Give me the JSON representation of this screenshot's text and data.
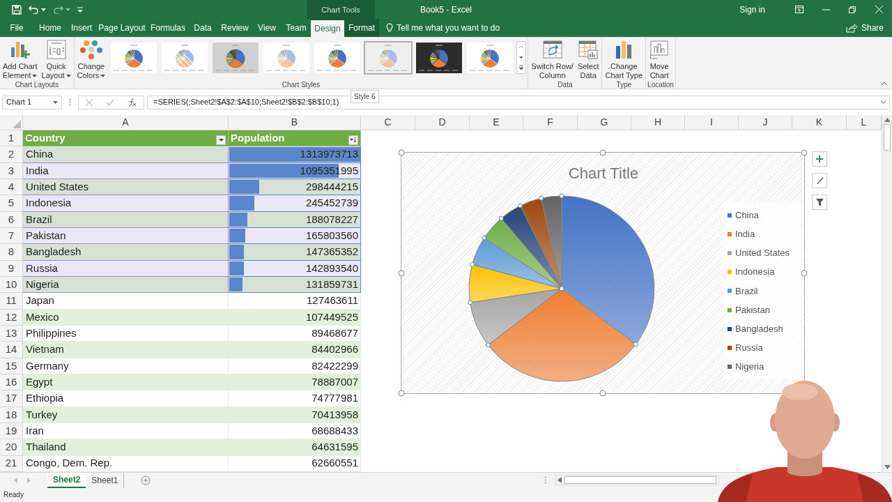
{
  "window": {
    "title": "Book5 - Excel",
    "account": "Sign in"
  },
  "context_label": "Chart Tools",
  "tabs": [
    {
      "label": "File",
      "selected": false,
      "contextual": false
    },
    {
      "label": "Home",
      "selected": false,
      "contextual": false
    },
    {
      "label": "Insert",
      "selected": false,
      "contextual": false
    },
    {
      "label": "Page Layout",
      "selected": false,
      "contextual": false
    },
    {
      "label": "Formulas",
      "selected": false,
      "contextual": false
    },
    {
      "label": "Data",
      "selected": false,
      "contextual": false
    },
    {
      "label": "Review",
      "selected": false,
      "contextual": false
    },
    {
      "label": "View",
      "selected": false,
      "contextual": false
    },
    {
      "label": "Team",
      "selected": false,
      "contextual": false
    },
    {
      "label": "Design",
      "selected": true,
      "contextual": true
    },
    {
      "label": "Format",
      "selected": false,
      "contextual": true
    }
  ],
  "tell_me": "Tell me what you want to do",
  "share": "Share",
  "ribbon": {
    "groups": [
      {
        "label": "Chart Layouts",
        "buttons": [
          {
            "lines": [
              "Add Chart",
              "Element"
            ],
            "dropdown": true
          },
          {
            "lines": [
              "Quick",
              "Layout"
            ],
            "dropdown": true
          }
        ]
      },
      {
        "label": "Chart Styles",
        "buttons": [
          {
            "lines": [
              "Change",
              "Colors"
            ],
            "dropdown": true
          }
        ],
        "gallery": [
          {
            "kind": "plain",
            "selected": false
          },
          {
            "kind": "striped",
            "selected": false
          },
          {
            "kind": "gray",
            "selected": false
          },
          {
            "kind": "pale",
            "selected": false
          },
          {
            "kind": "plain",
            "selected": false
          },
          {
            "kind": "hatched",
            "selected": true
          },
          {
            "kind": "dark",
            "selected": false
          },
          {
            "kind": "plain",
            "selected": false
          }
        ]
      },
      {
        "label": "Data",
        "buttons": [
          {
            "lines": [
              "Switch Row/",
              "Column"
            ],
            "dropdown": false
          },
          {
            "lines": [
              "Select",
              "Data"
            ],
            "dropdown": false
          }
        ]
      },
      {
        "label": "Type",
        "buttons": [
          {
            "lines": [
              "Change",
              "Chart Type"
            ],
            "dropdown": false
          }
        ]
      },
      {
        "label": "Location",
        "buttons": [
          {
            "lines": [
              "Move",
              "Chart"
            ],
            "dropdown": false
          }
        ]
      }
    ]
  },
  "formula_bar": {
    "name_box": "Chart 1",
    "formula": "=SERIES(;Sheet2!$A$2:$A$10;Sheet2!$B$2:$B$10;1)"
  },
  "tooltip": "Style 6",
  "sheet": {
    "columns": [
      "A",
      "B",
      "C",
      "D",
      "E",
      "F",
      "G",
      "H",
      "I",
      "J",
      "K",
      "L"
    ],
    "header_row": "1",
    "headers": [
      "Country",
      "Population"
    ],
    "rows": [
      {
        "row": "2",
        "country": "China",
        "population": "1313973713",
        "selected": true,
        "level": 1
      },
      {
        "row": "3",
        "country": "India",
        "population": "1095351995",
        "selected": true,
        "level": 0.83
      },
      {
        "row": "4",
        "country": "United States",
        "population": "298444215",
        "selected": true,
        "level": 0.23
      },
      {
        "row": "5",
        "country": "Indonesia",
        "population": "245452739",
        "selected": true,
        "level": 0.19
      },
      {
        "row": "6",
        "country": "Brazil",
        "population": "188078227",
        "selected": true,
        "level": 0.14
      },
      {
        "row": "7",
        "country": "Pakistan",
        "population": "165803560",
        "selected": true,
        "level": 0.12
      },
      {
        "row": "8",
        "country": "Bangladesh",
        "population": "147365352",
        "selected": true,
        "level": 0.11
      },
      {
        "row": "9",
        "country": "Russia",
        "population": "142893540",
        "selected": true,
        "level": 0.11
      },
      {
        "row": "10",
        "country": "Nigeria",
        "population": "131859731",
        "selected": true,
        "level": 0.1
      },
      {
        "row": "11",
        "country": "Japan",
        "population": "127463611",
        "selected": false
      },
      {
        "row": "12",
        "country": "Mexico",
        "population": "107449525",
        "selected": false
      },
      {
        "row": "13",
        "country": "Philippines",
        "population": "89468677",
        "selected": false
      },
      {
        "row": "14",
        "country": "Vietnam",
        "population": "84402966",
        "selected": false
      },
      {
        "row": "15",
        "country": "Germany",
        "population": "82422299",
        "selected": false
      },
      {
        "row": "16",
        "country": "Egypt",
        "population": "78887007",
        "selected": false
      },
      {
        "row": "17",
        "country": "Ethiopia",
        "population": "74777981",
        "selected": false
      },
      {
        "row": "18",
        "country": "Turkey",
        "population": "70413958",
        "selected": false
      },
      {
        "row": "19",
        "country": "Iran",
        "population": "68688433",
        "selected": false
      },
      {
        "row": "20",
        "country": "Thailand",
        "population": "64631595",
        "selected": false
      },
      {
        "row": "21",
        "country": "Congo, Dem. Rep.",
        "population": "62660551",
        "selected": false
      }
    ]
  },
  "chart": {
    "title": "Chart Title",
    "legend": [
      {
        "label": "China",
        "color": "#4472c4"
      },
      {
        "label": "India",
        "color": "#ed7d31"
      },
      {
        "label": "United States",
        "color": "#a5a5a5"
      },
      {
        "label": "Indonesia",
        "color": "#ffc000"
      },
      {
        "label": "Brazil",
        "color": "#5b9bd5"
      },
      {
        "label": "Pakistan",
        "color": "#70ad47"
      },
      {
        "label": "Bangladesh",
        "color": "#264478"
      },
      {
        "label": "Russia",
        "color": "#9e480e"
      },
      {
        "label": "Nigeria",
        "color": "#636363"
      }
    ]
  },
  "sheet_tabs": [
    {
      "label": "Sheet2",
      "selected": true
    },
    {
      "label": "Sheet1",
      "selected": false
    }
  ],
  "status": "Ready"
}
